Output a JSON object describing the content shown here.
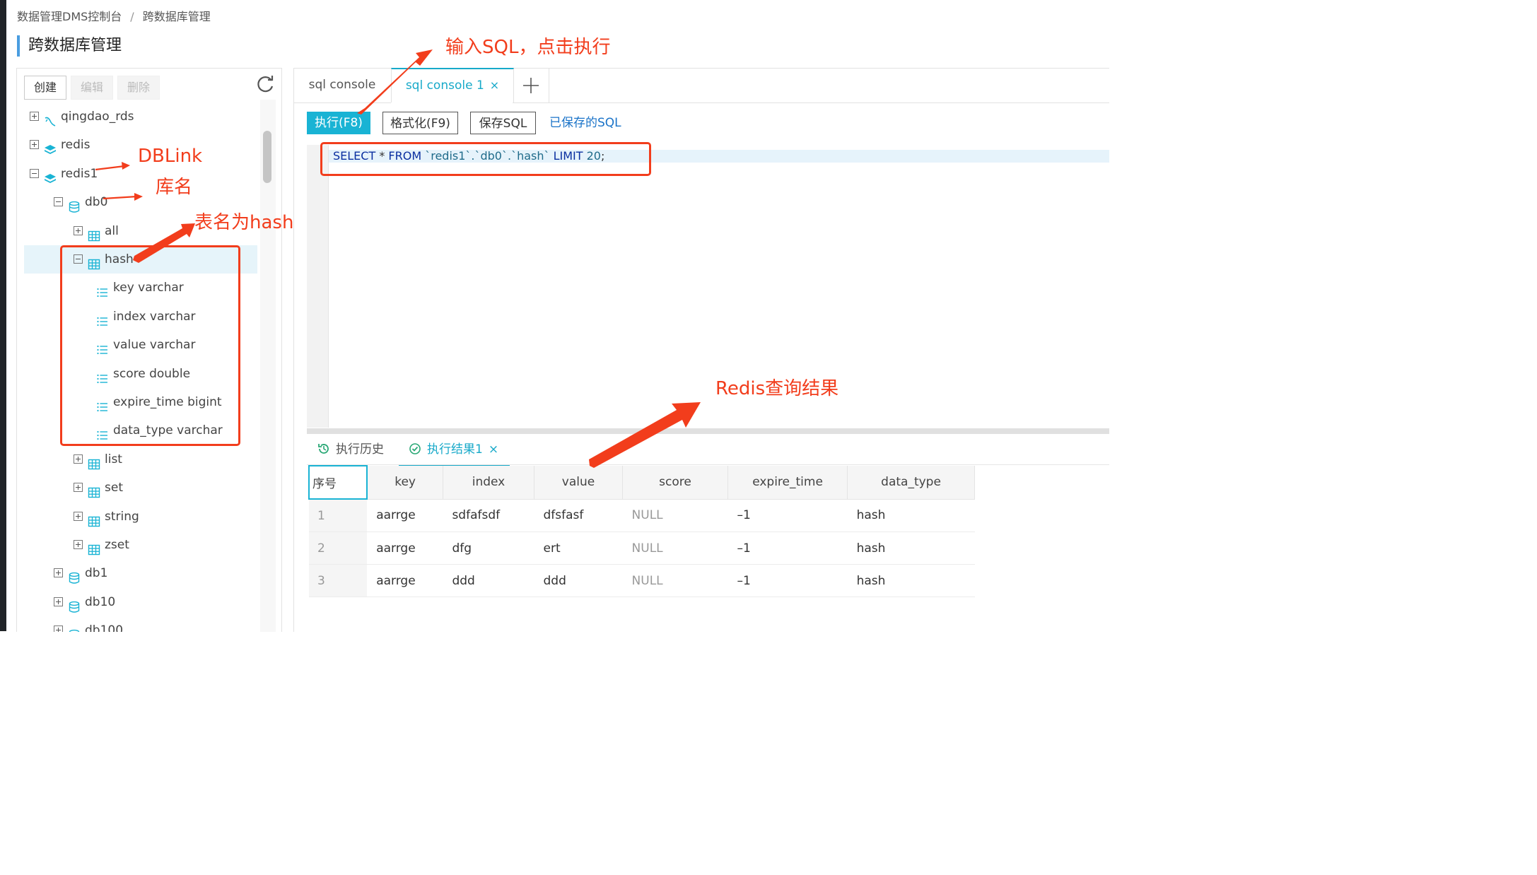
{
  "breadcrumb": {
    "root": "数据管理DMS控制台",
    "separator": "/",
    "current": "跨数据库管理"
  },
  "page_title": "跨数据库管理",
  "tree_toolbar": {
    "create": "创建",
    "edit": "编辑",
    "delete": "删除",
    "refresh_icon": "refresh-icon"
  },
  "tree": [
    {
      "label": "qingdao_rds",
      "icon": "rds-icon",
      "expanded": false,
      "level": 0
    },
    {
      "label": "redis",
      "icon": "stack-icon",
      "expanded": false,
      "level": 0
    },
    {
      "label": "redis1",
      "icon": "stack-icon",
      "expanded": true,
      "level": 0
    },
    {
      "label": "db0",
      "icon": "database-icon",
      "expanded": true,
      "level": 1
    },
    {
      "label": "all",
      "icon": "table-icon",
      "expanded": false,
      "level": 2
    },
    {
      "label": "hash",
      "icon": "table-icon",
      "expanded": true,
      "level": 2,
      "selected": true
    },
    {
      "label": "key varchar",
      "icon": "column-icon",
      "level": 3
    },
    {
      "label": "index varchar",
      "icon": "column-icon",
      "level": 3
    },
    {
      "label": "value varchar",
      "icon": "column-icon",
      "level": 3
    },
    {
      "label": "score double",
      "icon": "column-icon",
      "level": 3
    },
    {
      "label": "expire_time bigint",
      "icon": "column-icon",
      "level": 3
    },
    {
      "label": "data_type varchar",
      "icon": "column-icon",
      "level": 3
    },
    {
      "label": "list",
      "icon": "table-icon",
      "expanded": false,
      "level": 2
    },
    {
      "label": "set",
      "icon": "table-icon",
      "expanded": false,
      "level": 2
    },
    {
      "label": "string",
      "icon": "table-icon",
      "expanded": false,
      "level": 2
    },
    {
      "label": "zset",
      "icon": "table-icon",
      "expanded": false,
      "level": 2
    },
    {
      "label": "db1",
      "icon": "database-icon",
      "expanded": false,
      "level": 1
    },
    {
      "label": "db10",
      "icon": "database-icon",
      "expanded": false,
      "level": 1
    },
    {
      "label": "db100",
      "icon": "database-icon",
      "expanded": false,
      "level": 1
    }
  ],
  "tabs": {
    "tab1": "sql console",
    "tab2": "sql console 1",
    "close_glyph": "×",
    "add_glyph": "+"
  },
  "editor_toolbar": {
    "run": "执行(F8)",
    "format": "格式化(F9)",
    "save": "保存SQL",
    "saved_link": "已保存的SQL"
  },
  "sql": {
    "kw_select": "SELECT",
    "star": " * ",
    "kw_from": "FROM",
    "target": " `redis1`.`db0`.`hash` ",
    "kw_limit": "LIMIT",
    "limit_value": " 20",
    "terminator": ";"
  },
  "result_tabs": {
    "history": "执行历史",
    "result": "执行结果1",
    "close_glyph": "×"
  },
  "result_table": {
    "columns": [
      "序号",
      "key",
      "index",
      "value",
      "score",
      "expire_time",
      "data_type"
    ],
    "rows": [
      [
        "1",
        "aarrge",
        "sdfafsdf",
        "dfsfasf",
        "NULL",
        "–1",
        "hash"
      ],
      [
        "2",
        "aarrge",
        "dfg",
        "ert",
        "NULL",
        "–1",
        "hash"
      ],
      [
        "3",
        "aarrge",
        "ddd",
        "ddd",
        "NULL",
        "–1",
        "hash"
      ]
    ]
  },
  "annotations": {
    "input_sql": "输入SQL，点击执行",
    "dblink": "DBLink",
    "db_name": "库名",
    "table_name": "表名为hash",
    "redis_result": "Redis查询结果",
    "color": "#f23d1c"
  },
  "colors": {
    "accent": "#19b3d4",
    "tab_active": "#17a9c9",
    "link": "#1a73c8",
    "annotation": "#f23d1c"
  }
}
